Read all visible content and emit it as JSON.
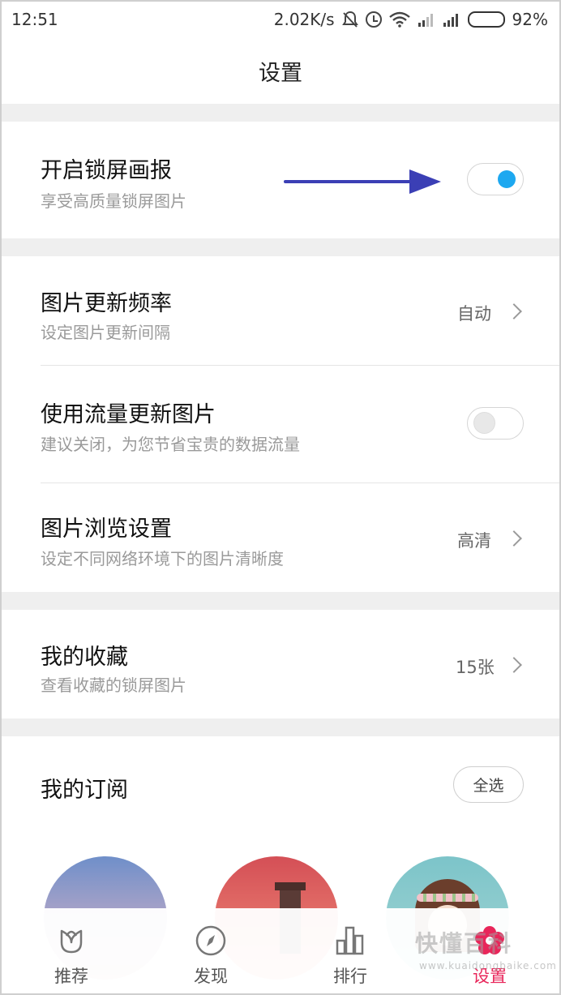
{
  "status_bar": {
    "time": "12:51",
    "network_speed": "2.02K/s",
    "battery": "92%"
  },
  "header": {
    "title": "设置"
  },
  "lockscreen": {
    "title": "开启锁屏画报",
    "subtitle": "享受高质量锁屏图片",
    "toggle_on": true
  },
  "update_frequency": {
    "title": "图片更新频率",
    "subtitle": "设定图片更新间隔",
    "value": "自动"
  },
  "mobile_data": {
    "title": "使用流量更新图片",
    "subtitle": "建议关闭，为您节省宝贵的数据流量",
    "toggle_on": false
  },
  "browse_settings": {
    "title": "图片浏览设置",
    "subtitle": "设定不同网络环境下的图片清晰度",
    "value": "高清"
  },
  "favorites": {
    "title": "我的收藏",
    "subtitle": "查看收藏的锁屏图片",
    "value": "15张"
  },
  "subscriptions": {
    "title": "我的订阅",
    "select_all": "全选"
  },
  "bottom_nav": [
    {
      "label": "推荐",
      "icon": "tulip-icon",
      "active": false
    },
    {
      "label": "发现",
      "icon": "compass-icon",
      "active": false
    },
    {
      "label": "排行",
      "icon": "bar-chart-icon",
      "active": false
    },
    {
      "label": "设置",
      "icon": "flower-settings-icon",
      "active": true
    }
  ],
  "watermark": {
    "text": "快懂百科",
    "sub": "www.kuaidongbaike.com"
  },
  "colors": {
    "accent": "#e8265a",
    "toggle_on": "#1da8f0",
    "annotation_arrow": "#3b3fb5"
  }
}
